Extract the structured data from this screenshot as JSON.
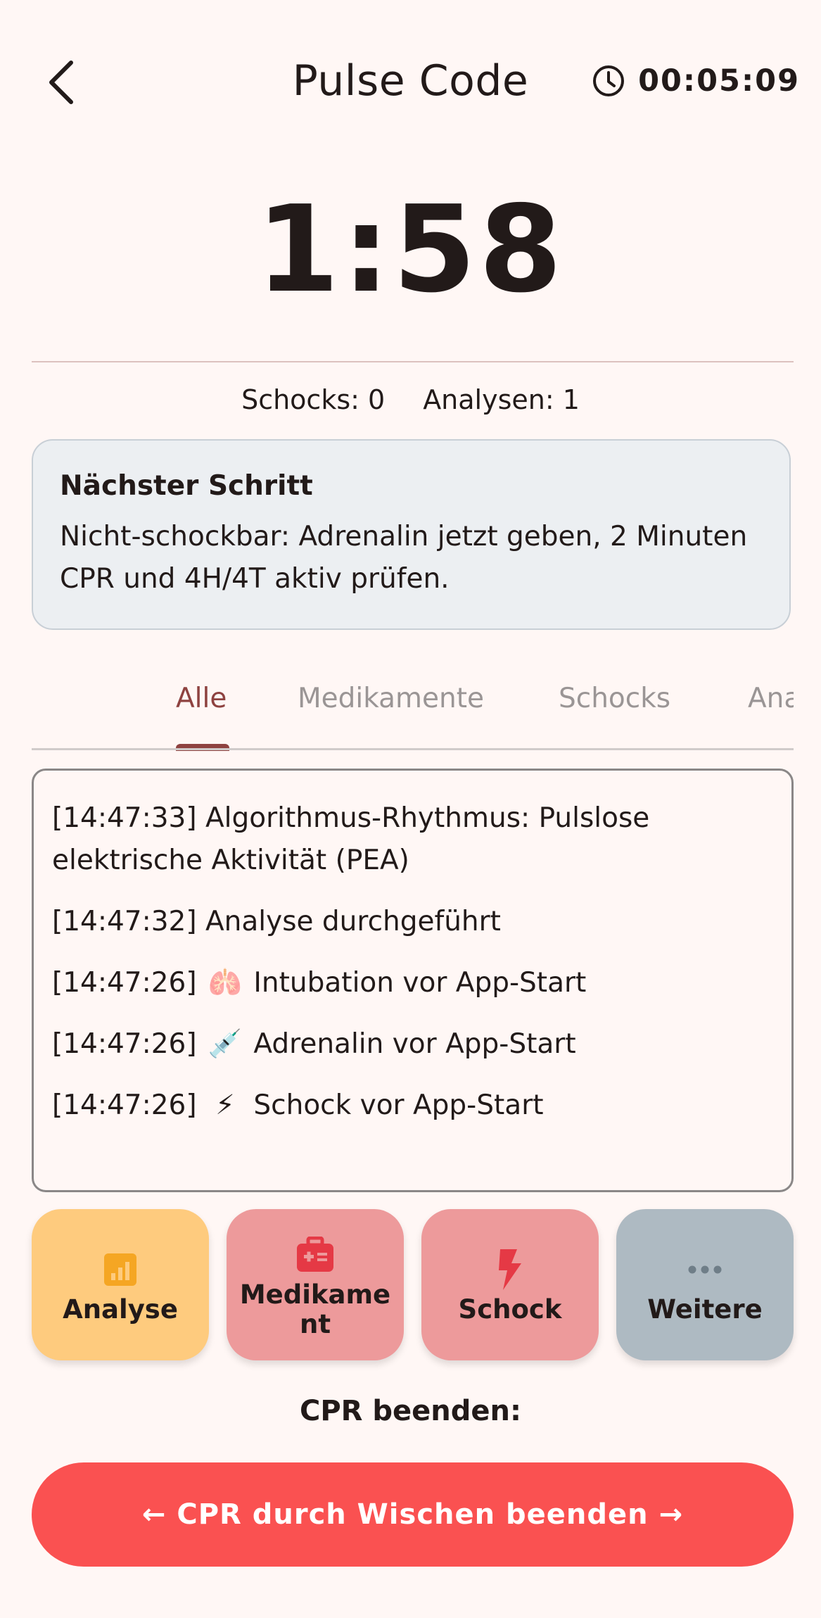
{
  "header": {
    "title": "Pulse Code",
    "elapsed": "00:05:09"
  },
  "countdown": "1:58",
  "stats": {
    "shocks": "Schocks: 0",
    "analyses": "Analysen: 1"
  },
  "next_step": {
    "title": "Nächster Schritt",
    "body": "Nicht-schockbar: Adrenalin jetzt geben, 2 Minuten CPR und 4H/4T aktiv prüfen."
  },
  "tabs": [
    {
      "label": "Alle",
      "active": true
    },
    {
      "label": "Medikamente",
      "active": false
    },
    {
      "label": "Schocks",
      "active": false
    },
    {
      "label": "Analysen",
      "active": false
    }
  ],
  "log": [
    {
      "time": "[14:47:33]",
      "emoji": "",
      "text": "Algorithmus-Rhythmus: Pulslose elektrische Aktivität (PEA)"
    },
    {
      "time": "[14:47:32]",
      "emoji": "",
      "text": "Analyse durchgeführt"
    },
    {
      "time": "[14:47:26]",
      "emoji": "🫁",
      "text": "Intubation vor App-Start"
    },
    {
      "time": "[14:47:26]",
      "emoji": "💉",
      "text": "Adrenalin vor App-Start"
    },
    {
      "time": "[14:47:26]",
      "emoji": "⚡",
      "text": "Schock vor App-Start"
    }
  ],
  "actions": [
    {
      "label": "Analyse",
      "icon": "analytics-icon",
      "color": "#fecb7e"
    },
    {
      "label": "Medikament",
      "icon": "medical-kit-icon",
      "color": "#ed9a9b"
    },
    {
      "label": "Schock",
      "icon": "lightning-bolt-icon",
      "color": "#ed9a9b"
    },
    {
      "label": "Weitere",
      "icon": "more-dots-icon",
      "color": "#aebac2"
    }
  ],
  "end_label": "CPR beenden:",
  "swipe_label": "← CPR durch Wischen beenden →",
  "colors": {
    "background": "#fff7f5",
    "accent": "#8e4240",
    "swipe": "#fa5151"
  }
}
